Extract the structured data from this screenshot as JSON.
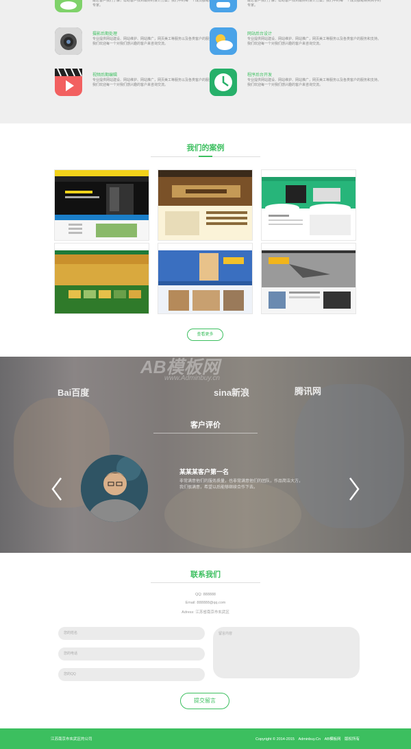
{
  "services": [
    {
      "title": "",
      "desc": "最近客户我们了解，帮助客户找到最好的设计方案，我们中的每一个成员都是精英高手的专家。",
      "icon": "chat-icon",
      "color": "#7fd26a"
    },
    {
      "title": "",
      "desc": "最近客户我们了解，帮助客户找到最好的设计方案，我们中的每一个成员都是精英高手的专家。",
      "icon": "location-icon",
      "color": "#4aa3e8"
    },
    {
      "title": "摄影后期处理",
      "desc": "专业提供网站建设、网站维护、网站推广，网页美工等服务以及各类客户的服务和支持。我们欢迎每一个对我们感兴趣的客户来咨询交流。",
      "icon": "camera-icon",
      "color": "#5a5a5a"
    },
    {
      "title": "网站后台设计",
      "desc": "专业提供网站建设、网站维护、网站推广，网页美工等服务以及各类客户的服务和支持。我们欢迎每一个对我们感兴趣的客户来咨询交流。",
      "icon": "weather-icon",
      "color": "#4aa3e8"
    },
    {
      "title": "视频后期编辑",
      "desc": "专业提供网站建设、网站维护、网站推广，网页美工等服务以及各类客户的服务和支持。我们欢迎每一个对我们感兴趣的客户来咨询交流。",
      "icon": "video-icon",
      "color": "#f26060"
    },
    {
      "title": "程序后台开发",
      "desc": "专业提供网站建设、网站维护、网站推广，网页美工等服务以及各类客户的服务和支持。我们欢迎每一个对我们感兴趣的客户来咨询交流。",
      "icon": "clock-icon",
      "color": "#27b06a"
    }
  ],
  "cases": {
    "title": "我们的案例",
    "more_label": "查看更多"
  },
  "brands": [
    "Bai百度",
    "sina新浪",
    "腾讯网"
  ],
  "testimonial": {
    "title": "客户评价",
    "name": "某某某客户第一名",
    "text": "非常满意他们的服务质量，也非常满意他们的团队，作品简洁大方，我们很满意，希望以后能够继续合作下去。",
    "watermark": "AB模板网",
    "watermark_sub": "www.Adminbuy.cn"
  },
  "contact": {
    "title": "联系我们",
    "qq": "QQ: 888888",
    "email": "Email: 888888@qq.com",
    "address": "Adress: 江苏省南京市玄武区",
    "name_placeholder": "您的姓名",
    "phone_placeholder": "您的电话",
    "email_placeholder": "您的QQ",
    "message_placeholder": "留言内容",
    "submit_label": "提交留言"
  },
  "footer": {
    "company": "江苏南京市玄武区的公司",
    "copyright": "Copyright © 2014-2015",
    "link1": "Adminbuy.Cn",
    "link2": "AB模板网",
    "link3": "版权所有"
  }
}
